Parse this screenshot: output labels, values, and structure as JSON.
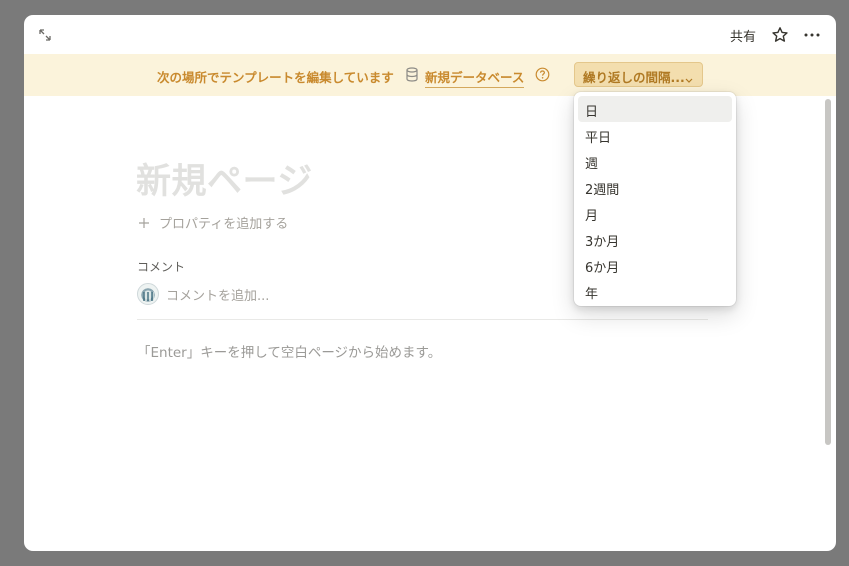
{
  "topbar": {
    "share_label": "共有"
  },
  "banner": {
    "message": "次の場所でテンプレートを編集しています",
    "database_link": "新規データベース",
    "repeat_button_label": "繰り返しの間隔..."
  },
  "page": {
    "title_placeholder": "新規ページ",
    "add_property_label": "プロパティを追加する",
    "comment_label": "コメント",
    "comment_placeholder": "コメントを追加...",
    "hint": "「Enter」キーを押して空白ページから始めます。"
  },
  "repeat_menu": {
    "items": [
      {
        "label": "日"
      },
      {
        "label": "平日"
      },
      {
        "label": "週"
      },
      {
        "label": "2週間"
      },
      {
        "label": "月"
      },
      {
        "label": "3か月"
      },
      {
        "label": "6か月"
      },
      {
        "label": "年"
      }
    ],
    "highlighted_index": 0
  },
  "colors": {
    "banner_bg": "#fbf3db",
    "banner_text": "#c98a2e",
    "repeat_button_bg": "#f3deae"
  }
}
